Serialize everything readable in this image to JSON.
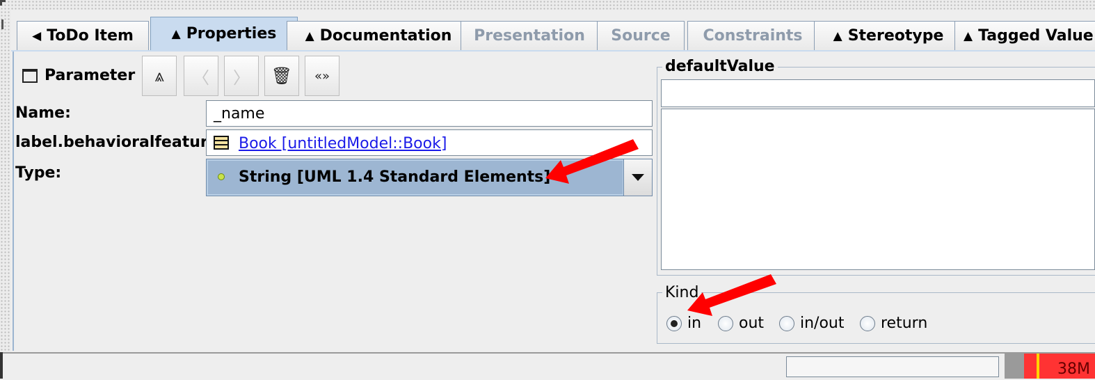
{
  "tabs": [
    {
      "label": "ToDo Item",
      "arrow": "◀",
      "state": "normal"
    },
    {
      "label": "Properties",
      "arrow": "▲",
      "state": "active"
    },
    {
      "label": "Documentation",
      "arrow": "▲",
      "state": "normal"
    },
    {
      "label": "Presentation",
      "arrow": "",
      "state": "disabled"
    },
    {
      "label": "Source",
      "arrow": "",
      "state": "disabled"
    },
    {
      "label": "Constraints",
      "arrow": "",
      "state": "disabled"
    },
    {
      "label": "Stereotype",
      "arrow": "▲",
      "state": "normal"
    },
    {
      "label": "Tagged Value",
      "arrow": "▲",
      "state": "normal"
    }
  ],
  "toolbar": {
    "title": "Parameter",
    "buttons": {
      "go_up": "⩓",
      "previous": "〈",
      "next": "〉",
      "delete": "🗑",
      "stereotype": "«»"
    }
  },
  "form": {
    "name_label": "Name:",
    "name_value": "_name",
    "owner_label": "label.behavioralfeature",
    "owner_link": "Book [untitledModel::Book]",
    "type_label": "Type:",
    "type_value": "String [UML 1.4 Standard Elements]"
  },
  "default_value": {
    "title": "defaultValue",
    "value": ""
  },
  "kind": {
    "title": "Kind",
    "options": [
      "in",
      "out",
      "in/out",
      "return"
    ],
    "selected": "in"
  },
  "status": {
    "memory": "38M"
  },
  "colors": {
    "annotation_arrow": "#ff0000",
    "active_tab": "#c9dbef",
    "combo_selected": "#9db6d2"
  }
}
